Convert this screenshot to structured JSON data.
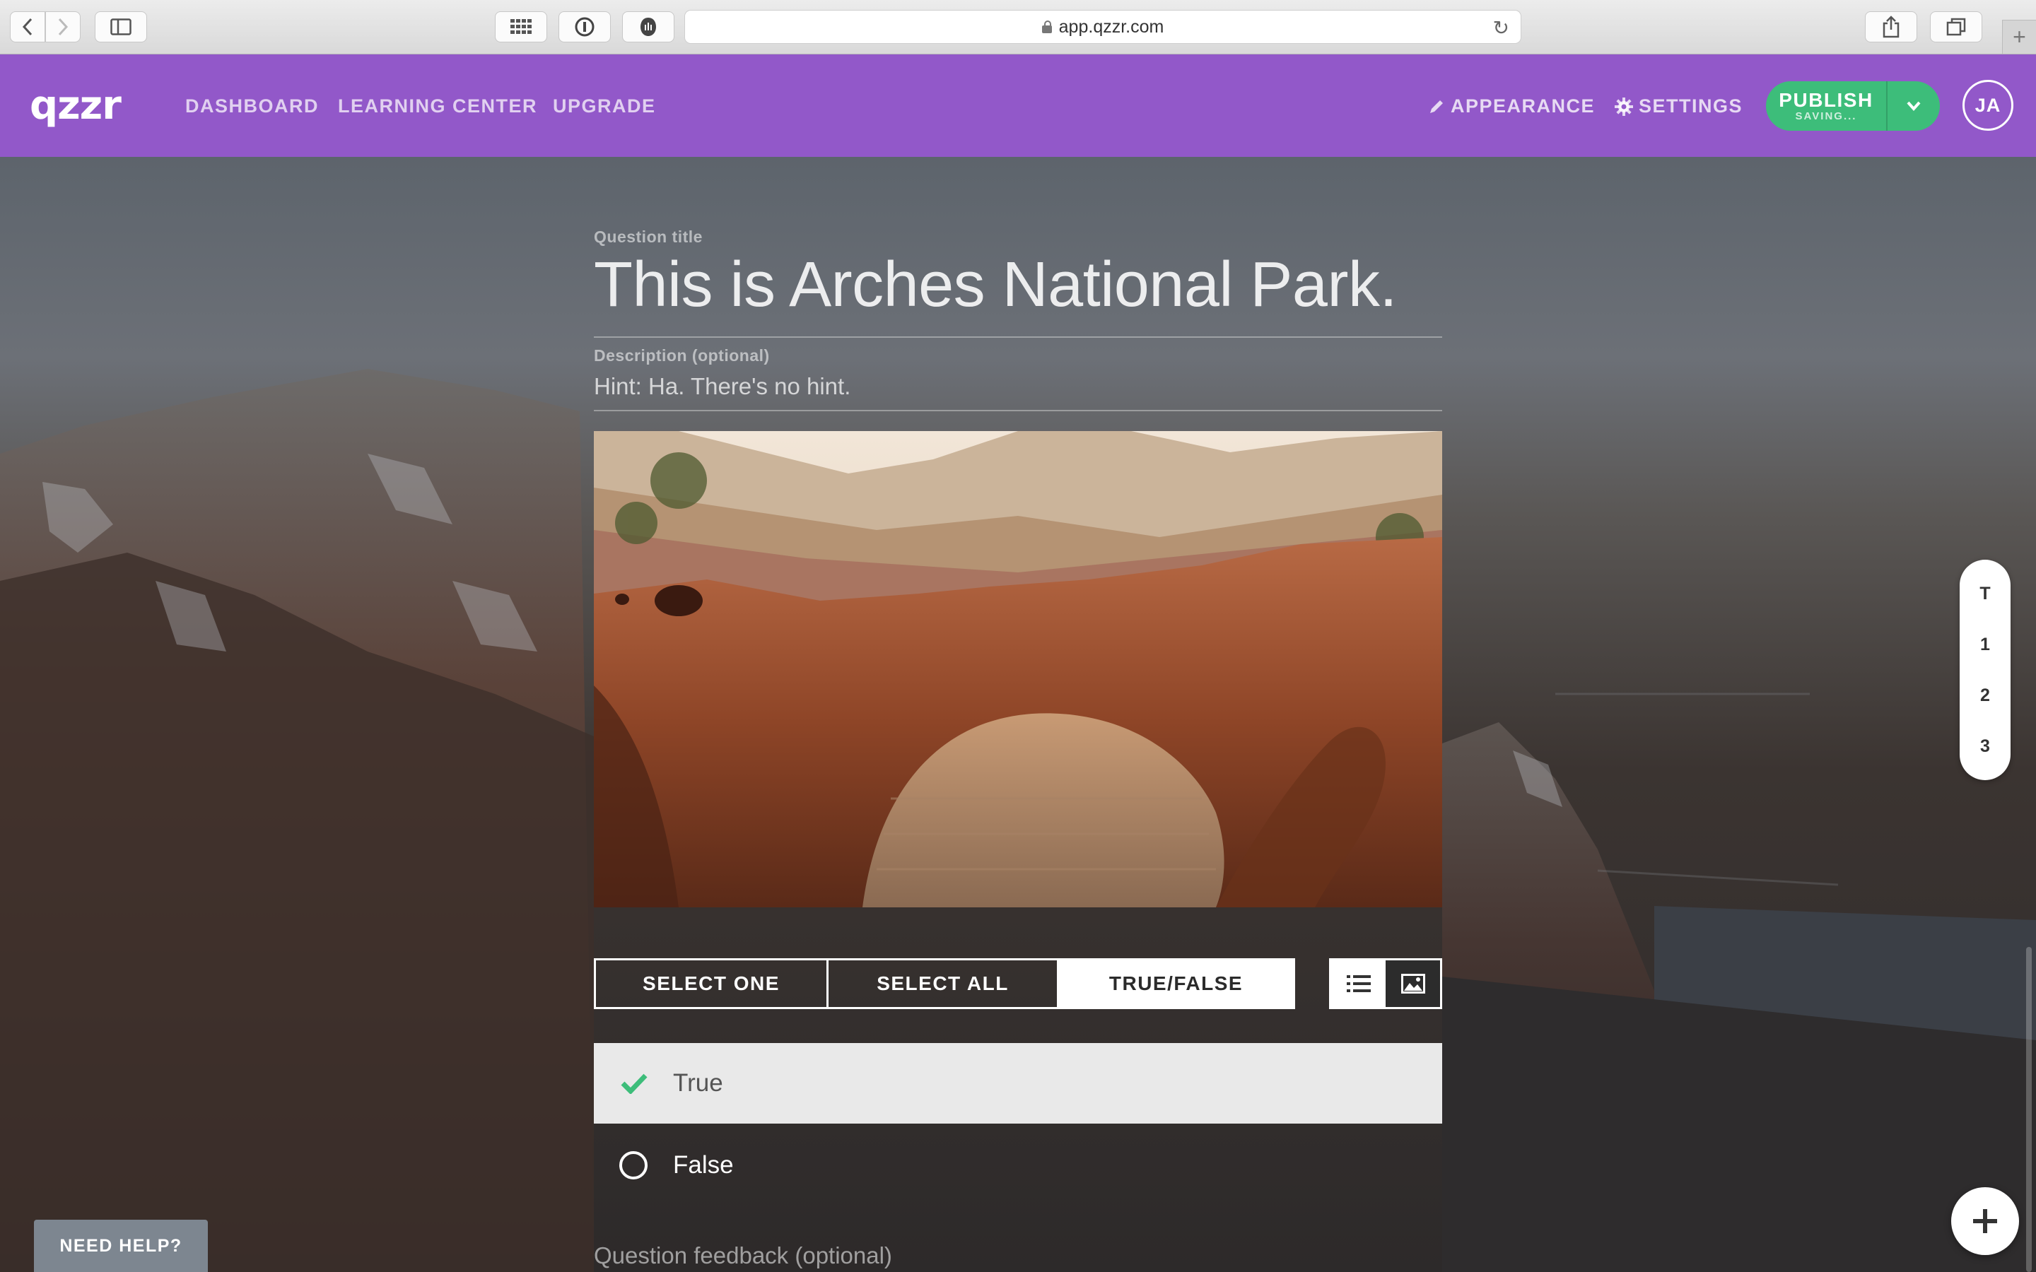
{
  "browser": {
    "url": "app.qzzr.com"
  },
  "nav": {
    "logo": "qzzr",
    "links": [
      "DASHBOARD",
      "LEARNING CENTER",
      "UPGRADE"
    ],
    "appearance": "APPEARANCE",
    "settings": "SETTINGS",
    "publish": {
      "label": "PUBLISH",
      "status": "SAVING..."
    },
    "avatar_initials": "JA"
  },
  "question": {
    "title_label": "Question title",
    "title": "This is Arches National Park.",
    "description_label": "Description (optional)",
    "description": "Hint: Ha. There's no hint.",
    "types": [
      "SELECT ONE",
      "SELECT ALL",
      "TRUE/FALSE"
    ],
    "active_type": "TRUE/FALSE",
    "answers": [
      {
        "label": "True",
        "correct": true
      },
      {
        "label": "False",
        "correct": false
      }
    ],
    "feedback_placeholder": "Question feedback (optional)"
  },
  "side_nav": [
    "T",
    "1",
    "2",
    "3"
  ],
  "help_button": "NEED HELP?",
  "colors": {
    "brand_purple": "#9258c9",
    "publish_green": "#3dbd7a",
    "check_green": "#3dbd7a"
  }
}
